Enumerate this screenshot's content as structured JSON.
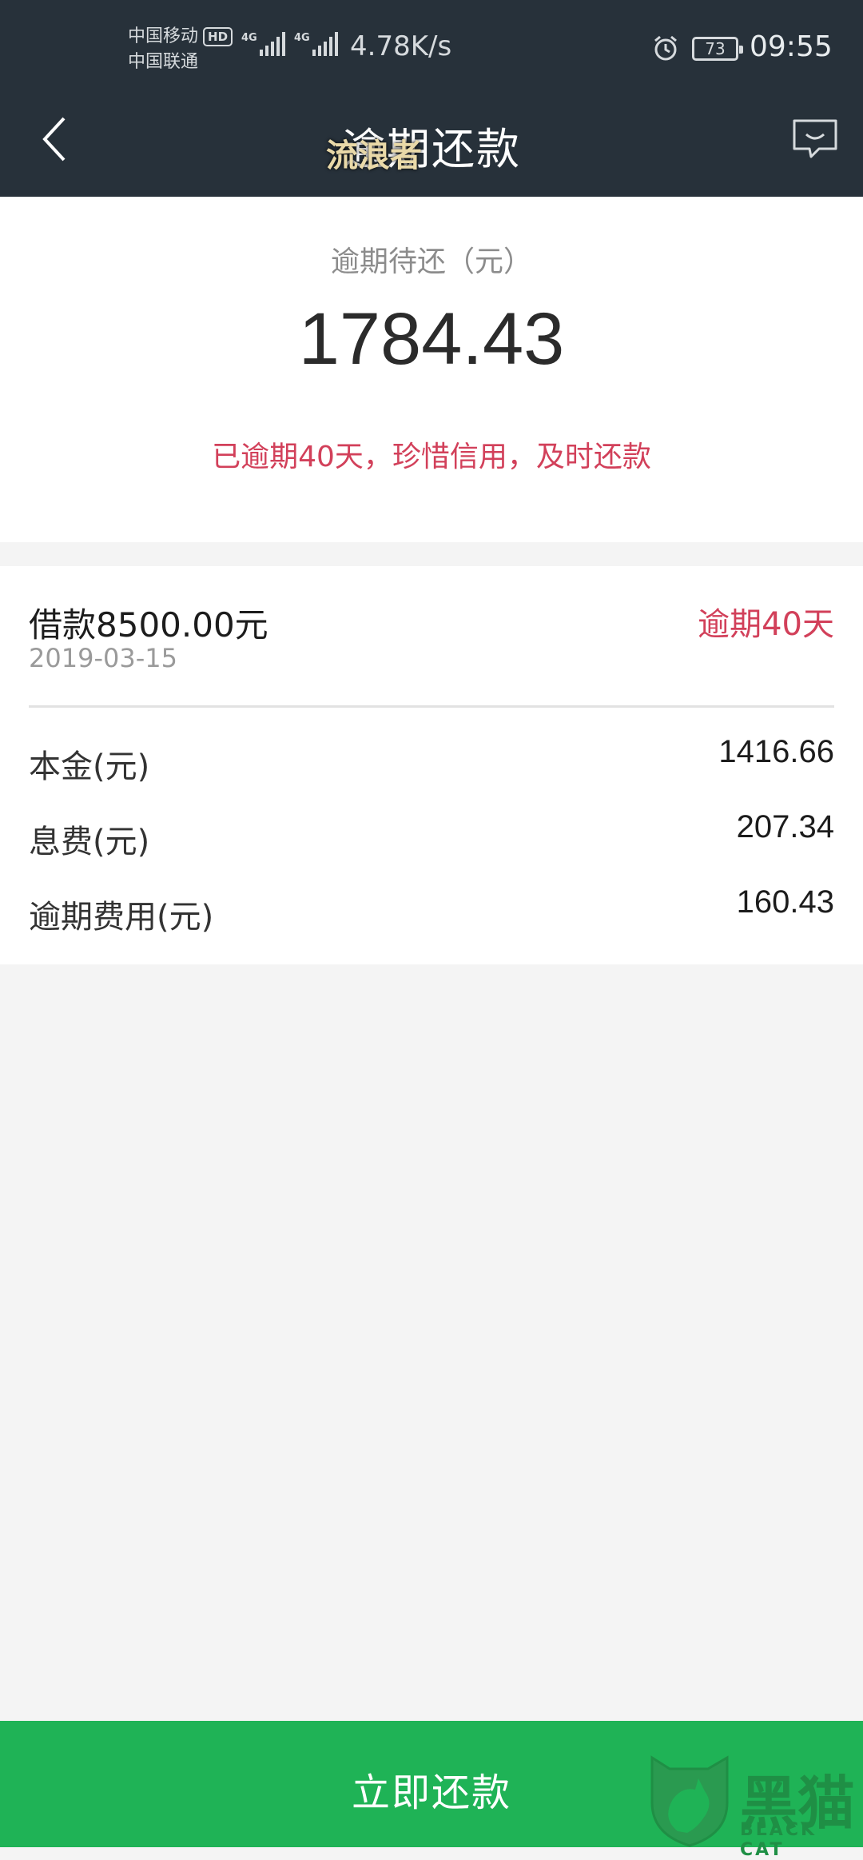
{
  "status_bar": {
    "carrier1": "中国移动",
    "hd_badge": "HD",
    "carrier2": "中国联通",
    "signal1_tag": "4G",
    "signal2_tag": "4G",
    "net_speed": "4.78K/s",
    "battery": "73",
    "time": "09:55"
  },
  "nav": {
    "title": "逾期还款",
    "overlay_text": "流浪者"
  },
  "summary": {
    "label": "逾期待还（元）",
    "amount": "1784.43",
    "notice": "已逾期40天，珍惜信用，及时还款"
  },
  "loan": {
    "title": "借款8500.00元",
    "date": "2019-03-15",
    "overdue_tag": "逾期40天",
    "rows": [
      {
        "label": "本金(元)",
        "value": "1416.66"
      },
      {
        "label": "息费(元)",
        "value": "207.34"
      },
      {
        "label": "逾期费用(元)",
        "value": "160.43"
      }
    ]
  },
  "footer": {
    "pay_button": "立即还款"
  },
  "watermark": {
    "cn": "黑猫",
    "en": "BLACK CAT"
  },
  "colors": {
    "header_bg": "#27313a",
    "accent_red": "#d2405a",
    "pay_green": "#1fb356",
    "page_bg": "#f4f4f4"
  }
}
